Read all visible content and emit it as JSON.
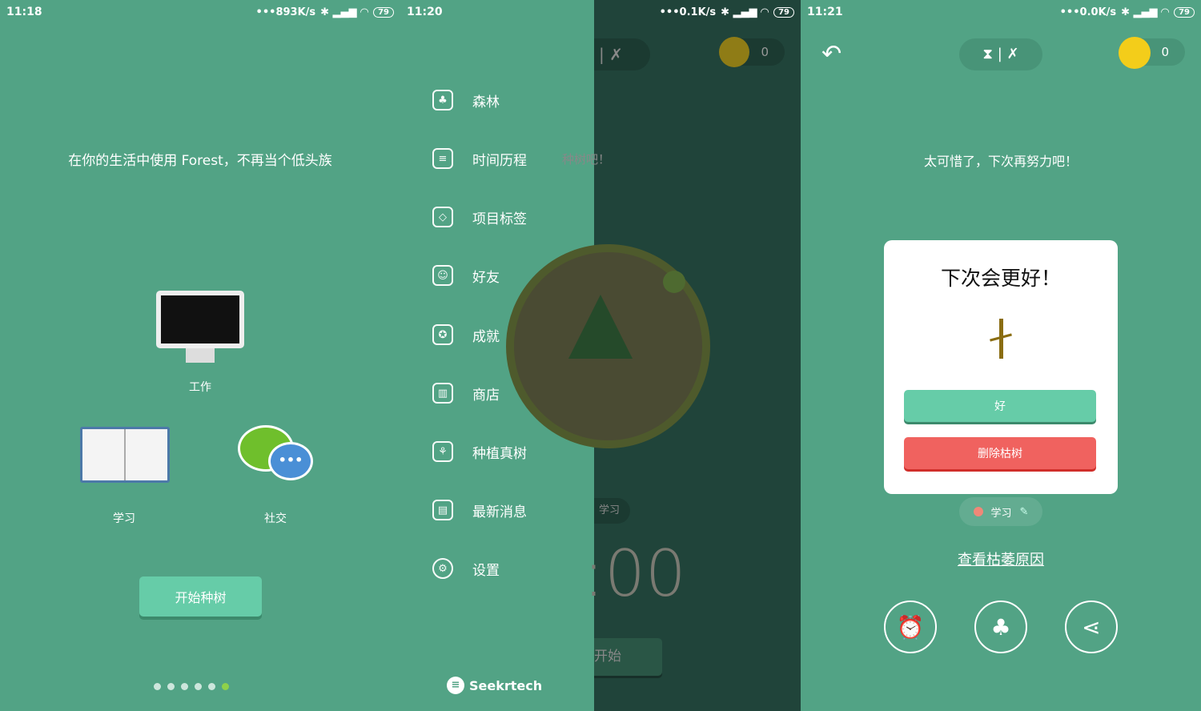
{
  "colors": {
    "bg": "#52a385",
    "accent": "#66cca8",
    "danger": "#f0625f",
    "coin": "#f3cd1a",
    "overlay": "#20443a"
  },
  "screen1": {
    "status": {
      "time": "11:18",
      "speed": "•••893K/s",
      "battery": "79"
    },
    "headline": "在你的生活中使用 Forest，不再当个低头族",
    "categories": [
      {
        "label": "工作",
        "icon": "monitor-icon"
      },
      {
        "label": "学习",
        "icon": "book-icon"
      },
      {
        "label": "社交",
        "icon": "chat-icon"
      }
    ],
    "start_button": "开始种树",
    "page_dots": 6,
    "active_dot": 6
  },
  "screen2": {
    "status": {
      "time": "11:20",
      "speed": "•••0.1K/s",
      "battery": "79"
    },
    "menu": [
      {
        "label": "森林",
        "icon": "forest-icon"
      },
      {
        "label": "时间历程",
        "icon": "timeline-icon"
      },
      {
        "label": "项目标签",
        "icon": "tag-icon"
      },
      {
        "label": "好友",
        "icon": "friends-icon"
      },
      {
        "label": "成就",
        "icon": "achievement-icon"
      },
      {
        "label": "商店",
        "icon": "store-icon"
      },
      {
        "label": "种植真树",
        "icon": "sprout-icon"
      },
      {
        "label": "最新消息",
        "icon": "news-icon"
      },
      {
        "label": "设置",
        "icon": "gear-icon"
      }
    ],
    "brand": "Seekrtech",
    "background": {
      "coins": "0",
      "prompt": "种树吧！",
      "tag": "学习",
      "timer": ":00",
      "start": "开始"
    }
  },
  "screen3": {
    "status": {
      "time": "11:21",
      "speed": "•••0.0K/s",
      "battery": "79"
    },
    "coins": "0",
    "message": "太可惜了，下次再努力吧！",
    "dialog": {
      "title": "下次会更好！",
      "ok": "好",
      "delete": "删除枯树"
    },
    "tag": "学习",
    "link": "查看枯萎原因"
  }
}
